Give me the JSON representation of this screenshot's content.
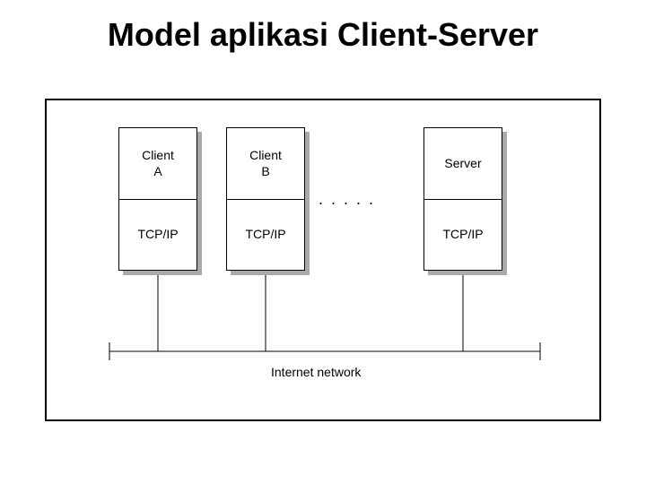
{
  "title": "Model aplikasi Client-Server",
  "nodes": {
    "a": {
      "top": "Client\nA",
      "bottom": "TCP/IP"
    },
    "b": {
      "top": "Client\nB",
      "bottom": "TCP/IP"
    },
    "server": {
      "top": "Server",
      "bottom": "TCP/IP"
    }
  },
  "ellipsis": ". . . . .",
  "network_label": "Internet network"
}
